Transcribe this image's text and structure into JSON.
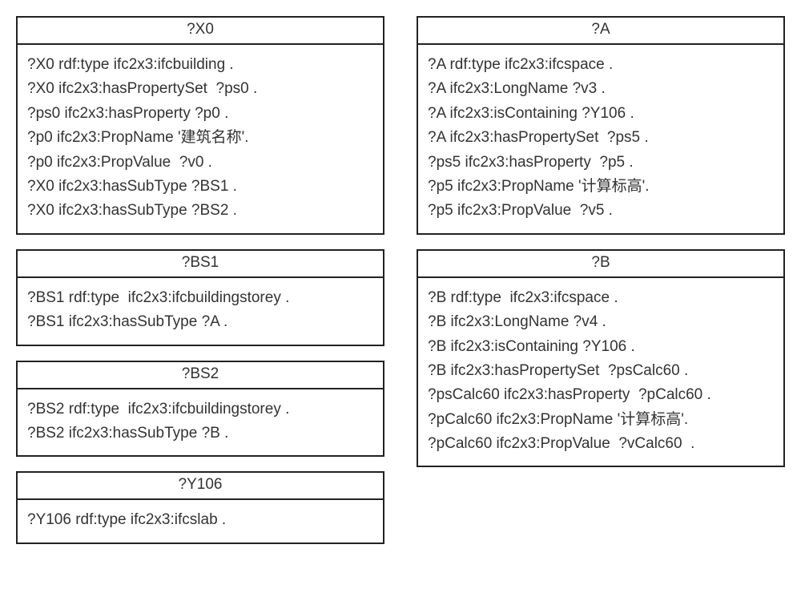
{
  "left": {
    "x0": {
      "title": "?X0",
      "lines": [
        "?X0 rdf:type ifc2x3:ifcbuilding .",
        "?X0 ifc2x3:hasPropertySet  ?ps0 .",
        "?ps0 ifc2x3:hasProperty ?p0 .",
        "?p0 ifc2x3:PropName '建筑名称'.",
        "?p0 ifc2x3:PropValue  ?v0 .",
        "?X0 ifc2x3:hasSubType ?BS1 .",
        "?X0 ifc2x3:hasSubType ?BS2 ."
      ]
    },
    "bs1": {
      "title": "?BS1",
      "lines": [
        "?BS1 rdf:type  ifc2x3:ifcbuildingstorey .",
        "?BS1 ifc2x3:hasSubType ?A ."
      ]
    },
    "bs2": {
      "title": "?BS2",
      "lines": [
        "?BS2 rdf:type  ifc2x3:ifcbuildingstorey .",
        "?BS2 ifc2x3:hasSubType ?B ."
      ]
    },
    "y106": {
      "title": "?Y106",
      "lines": [
        "?Y106 rdf:type ifc2x3:ifcslab ."
      ]
    }
  },
  "right": {
    "a": {
      "title": "?A",
      "lines": [
        "?A rdf:type ifc2x3:ifcspace .",
        "?A ifc2x3:LongName ?v3 .",
        "?A ifc2x3:isContaining ?Y106 .",
        "?A ifc2x3:hasPropertySet  ?ps5 .",
        "?ps5 ifc2x3:hasProperty  ?p5 .",
        "?p5 ifc2x3:PropName '计算标高'.",
        "?p5 ifc2x3:PropValue  ?v5 ."
      ]
    },
    "b": {
      "title": "?B",
      "lines": [
        "?B rdf:type  ifc2x3:ifcspace .",
        "?B ifc2x3:LongName ?v4 .",
        "?B ifc2x3:isContaining ?Y106 .",
        "?B ifc2x3:hasPropertySet  ?psCalc60 .",
        "?psCalc60 ifc2x3:hasProperty  ?pCalc60 .",
        "?pCalc60 ifc2x3:PropName '计算标高'.",
        "?pCalc60 ifc2x3:PropValue  ?vCalc60  ."
      ]
    }
  }
}
